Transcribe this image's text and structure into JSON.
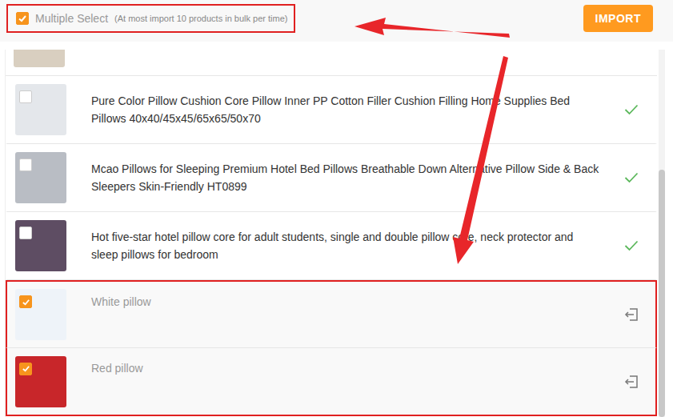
{
  "toolbar": {
    "multiple_select": {
      "label": "Multiple Select",
      "checked": true,
      "highlighted": true
    },
    "hint": "(At most import 10 products in bulk per time)",
    "import_button": "IMPORT"
  },
  "list": {
    "cut_row_above": true,
    "cut_row_color": "#d9cfc0"
  },
  "products": [
    {
      "title": "Pure Color Pillow Cushion Core Pillow Inner PP Cotton Filler Cushion Filling Home Supplies Bed Pillows 40x40/45x45/65x65/50x70",
      "checked": false,
      "imported": true,
      "highlighted": false,
      "color": "#e4e7eb"
    },
    {
      "title": "Mcao Pillows for Sleeping Premium Hotel Bed Pillows Breathable Down Alternative Pillow Side & Back Sleepers Skin-Friendly HT0899",
      "checked": false,
      "imported": true,
      "highlighted": false,
      "color": "#b9bdc4"
    },
    {
      "title": "Hot five-star hotel pillow core for adult students, single and double pillow core, neck protector and sleep pillows for bedroom",
      "checked": false,
      "imported": true,
      "highlighted": false,
      "color": "#5e4d63"
    },
    {
      "title": "White pillow",
      "checked": true,
      "imported": false,
      "highlighted": true,
      "color": "#eef3f9"
    },
    {
      "title": "Red pillow",
      "checked": true,
      "imported": false,
      "highlighted": true,
      "color": "#c8262a"
    }
  ]
}
